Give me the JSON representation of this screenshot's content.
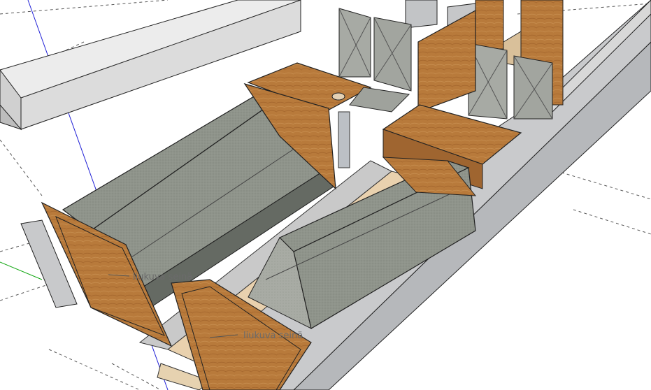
{
  "annotations": [
    {
      "id": "wall-label-1",
      "text": "liukuva seinä"
    },
    {
      "id": "wall-label-2",
      "text": "liukuva seinä"
    }
  ],
  "colors": {
    "background": "#ffffff",
    "wood": "#b8793a",
    "wood_dark": "#8a5420",
    "cushion": "#8e938a",
    "cushion_dark": "#6f746c",
    "seat": "#a9aca5",
    "floor_light": "#ead3b0",
    "hull": "#c8c9cb",
    "hull_dark": "#9fa1a4",
    "edge": "#2a2a2a",
    "axis_red": "#d21f1f",
    "axis_blue": "#2020d6",
    "axis_green": "#12a712"
  }
}
